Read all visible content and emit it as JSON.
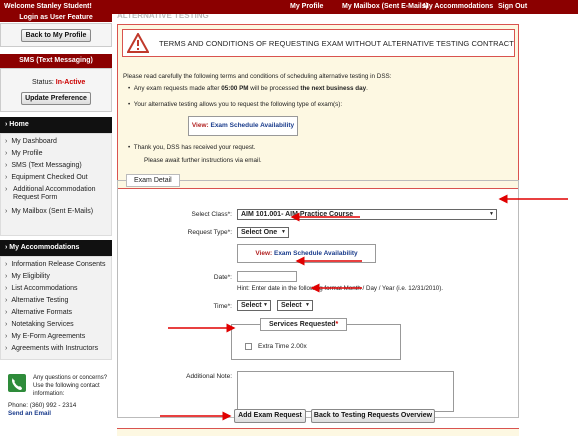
{
  "topbar": {
    "welcome": "Welcome Stanley Student!",
    "nav": [
      "My Profile",
      "My Mailbox (Sent E-Mails)",
      "My Accommodations",
      "Sign Out"
    ]
  },
  "sidebar": {
    "login_title": "Login as User Feature",
    "back_to_profile": "Back to My Profile",
    "sms_title": "SMS (Text Messaging)",
    "status_label": "Status:",
    "status_value": "In-Active",
    "update_pref": "Update Preference",
    "home_head": "Home",
    "home_items": [
      "My Dashboard",
      "My Profile",
      "SMS (Text Messaging)",
      "Equipment Checked Out",
      "Additional Accommodation Request Form",
      "My Mailbox (Sent E-Mails)"
    ],
    "accom_head": "My Accommodations",
    "accom_items": [
      "Information Release Consents",
      "My Eligibility",
      "List Accommodations",
      "Alternative Testing",
      "Alternative Formats",
      "Notetaking Services",
      "My E-Form Agreements",
      "Agreements with Instructors"
    ],
    "contact_text": "Any questions or concerns? Use the following contact information:",
    "phone": "Phone: (360) 992 - 2314",
    "email_link": "Send an Email"
  },
  "main": {
    "page_title": "ALTERNATIVE TESTING",
    "terms_title": "TERMS AND CONDITIONS OF REQUESTING EXAM WITHOUT ALTERNATIVE TESTING CONTRACT",
    "intro": "Please read carefully the following terms and conditions of scheduling alternative testing in DSS:",
    "bullet1_pre": "Any exam requests made after ",
    "bullet1_time": "05:00 PM",
    "bullet1_mid": " will be processed ",
    "bullet1_bold": "the next business day",
    "bullet1_end": ".",
    "bullet2": "Your alternative testing allows you to request the following type of exam(s):",
    "view_label": "View:",
    "view_link": "Exam Schedule Availability",
    "bullet3": "Thank you, DSS has received your request.",
    "await": "Please await further instructions via email.",
    "exam_detail": "Exam Detail",
    "select_class_label": "Select Class*:",
    "select_class_value": "AIM 101.001- AIM Practice Course",
    "request_type_label": "Request Type*:",
    "request_type_value": "Select One",
    "date_label": "Date*:",
    "date_hint": "Hint: Enter date in the following format Month / Day / Year (i.e. 12/31/2010).",
    "time_label": "Time*:",
    "time_hour": "Select",
    "time_min": "Select",
    "services_title": "Services Requested",
    "services_req": "*",
    "service_item": "Extra Time 2.00x",
    "additional_note": "Additional Note:",
    "add_exam": "Add Exam Request",
    "back_requests": "Back to Testing Requests Overview"
  },
  "colors": {
    "brand": "#8b0000",
    "alert_border": "#d9534f",
    "alert_bg": "#fdf8e2",
    "arrow": "#e00000"
  }
}
